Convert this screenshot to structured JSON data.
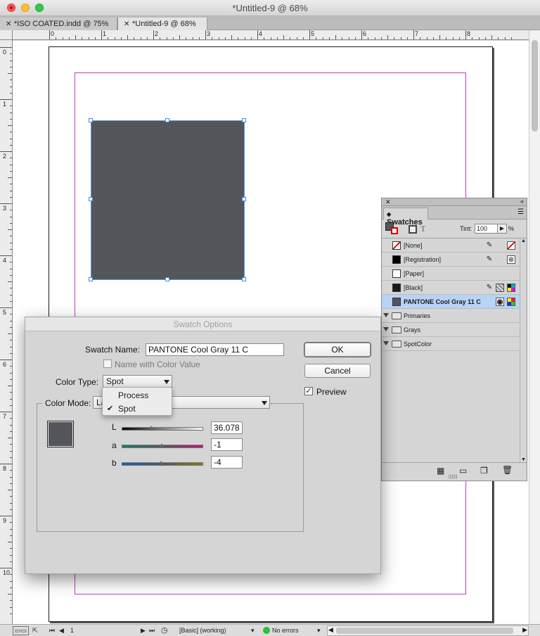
{
  "window": {
    "title": "*Untitled-9 @ 68%"
  },
  "tabs": [
    {
      "label": "*ISO COATED.indd @ 75%"
    },
    {
      "label": "*Untitled-9 @ 68%"
    }
  ],
  "ruler": {
    "h_numbers": [
      "0",
      "1",
      "2",
      "3",
      "4",
      "5",
      "6",
      "7",
      "8"
    ],
    "v_numbers": [
      "0",
      "1",
      "2",
      "3",
      "4",
      "5",
      "6",
      "7",
      "8",
      "9",
      "10"
    ]
  },
  "status": {
    "page": "1",
    "style": "[Basic] (working)",
    "preflight": "No errors"
  },
  "swatches_panel": {
    "title": "Swatches",
    "tint_label": "Tint:",
    "tint_value": "100",
    "tint_unit": "%",
    "items": [
      {
        "name": "[None]",
        "color": "#ffffff"
      },
      {
        "name": "[Registration]",
        "color": "#000000"
      },
      {
        "name": "[Paper]",
        "color": "#ffffff"
      },
      {
        "name": "[Black]",
        "color": "#1a1a1a"
      },
      {
        "name": "PANTONE Cool Gray 11 C",
        "color": "#55565c"
      }
    ],
    "groups": [
      {
        "name": "Primaries"
      },
      {
        "name": "Grays"
      },
      {
        "name": "SpotColor"
      }
    ]
  },
  "dialog": {
    "title": "Swatch Options",
    "swatch_name_label": "Swatch Name:",
    "swatch_name_value": "PANTONE Cool Gray 11 C",
    "name_with_color_value_label": "Name with Color Value",
    "color_type_label": "Color Type:",
    "color_type_value": "Spot",
    "color_type_options": [
      "Process",
      "Spot"
    ],
    "color_mode_label": "Color Mode:",
    "color_mode_value": "La",
    "ok_label": "OK",
    "cancel_label": "Cancel",
    "preview_label": "Preview",
    "channels": [
      {
        "label": "L",
        "value": "36.078",
        "position": 0.36
      },
      {
        "label": "a",
        "value": "-1",
        "position": 0.49
      },
      {
        "label": "b",
        "value": "-4",
        "position": 0.48
      }
    ]
  },
  "colors": {
    "swatch": "#55565c",
    "margin_guide": "#c13fc1",
    "selection": "#5b9bd5",
    "selected_row": "#b8d3f5"
  }
}
